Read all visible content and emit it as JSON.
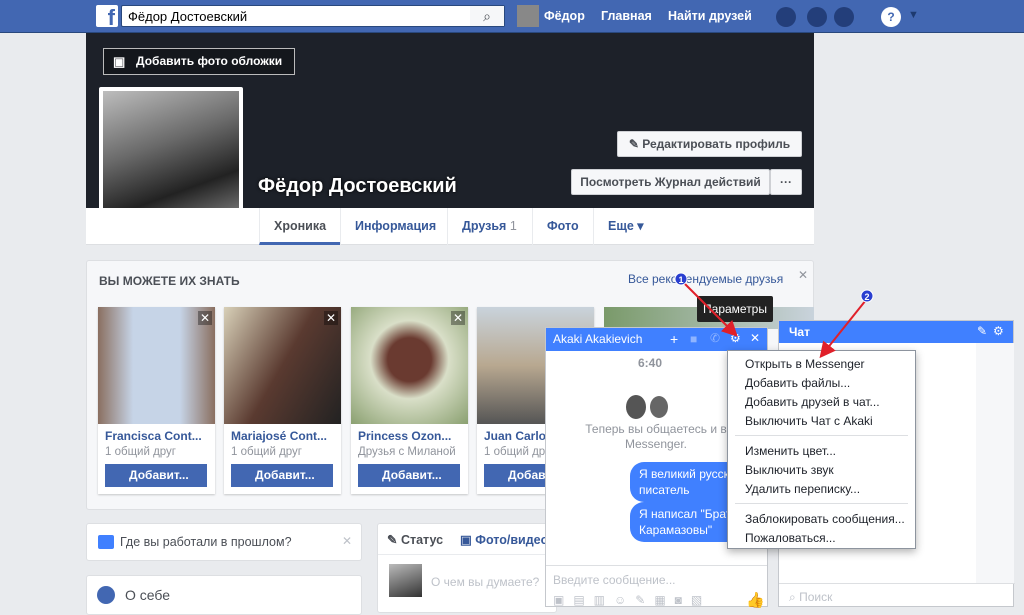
{
  "topbar": {
    "search_value": "Фёдор Достоевский",
    "user": "Фёдор",
    "home": "Главная",
    "find_friends": "Найти друзей"
  },
  "cover": {
    "add_cover": "Добавить фото обложки",
    "name": "Фёдор Достоевский",
    "edit_profile": "Редактировать профиль",
    "activity_log": "Посмотреть Журнал действий",
    "more": "···"
  },
  "tabs": [
    {
      "label": "Хроника"
    },
    {
      "label": "Информация"
    },
    {
      "label": "Друзья",
      "count": "1"
    },
    {
      "label": "Фото"
    },
    {
      "label": "Еще ▾"
    }
  ],
  "pymk": {
    "title": "ВЫ МОЖЕТЕ ИХ ЗНАТЬ",
    "see_all": "Все рекомендуемые друзья",
    "add_label": "Добавит...",
    "people": [
      {
        "name": "Francisca Cont...",
        "mutual": "1 общий друг"
      },
      {
        "name": "Mariajosé Cont...",
        "mutual": "1 общий друг"
      },
      {
        "name": "Princess Ozon...",
        "mutual": "Друзья с Миланой"
      },
      {
        "name": "Juan Carlos...",
        "mutual": "1 общий друг"
      }
    ]
  },
  "left": {
    "work_prompt": "Где вы работали в прошлом?",
    "about": "О себе"
  },
  "composer": {
    "status": "Статус",
    "photo": "Фото/видео",
    "placeholder": "О чем вы думаете?"
  },
  "chat": {
    "contact": "Akaki Akakievich",
    "time": "6:40",
    "intro": "Теперь вы общаетесь и в Messenger.",
    "messages": [
      "Я великий русский писатель",
      "Я написал \"Братья Карамазовы\""
    ],
    "input_placeholder": "Введите сообщение..."
  },
  "tooltip": "Параметры",
  "menu": {
    "group1": [
      "Открыть в Messenger",
      "Добавить файлы...",
      "Добавить друзей в чат...",
      "Выключить Чат с Akaki"
    ],
    "group2": [
      "Изменить цвет...",
      "Выключить звук",
      "Удалить переписку..."
    ],
    "group3": [
      "Заблокировать сообщения...",
      "Пожаловаться..."
    ]
  },
  "sidebar_chat": {
    "title": "Чат",
    "search_placeholder": "Поиск"
  },
  "annotations": {
    "marker1": "1",
    "marker2": "2",
    "color": "#e0202a"
  }
}
